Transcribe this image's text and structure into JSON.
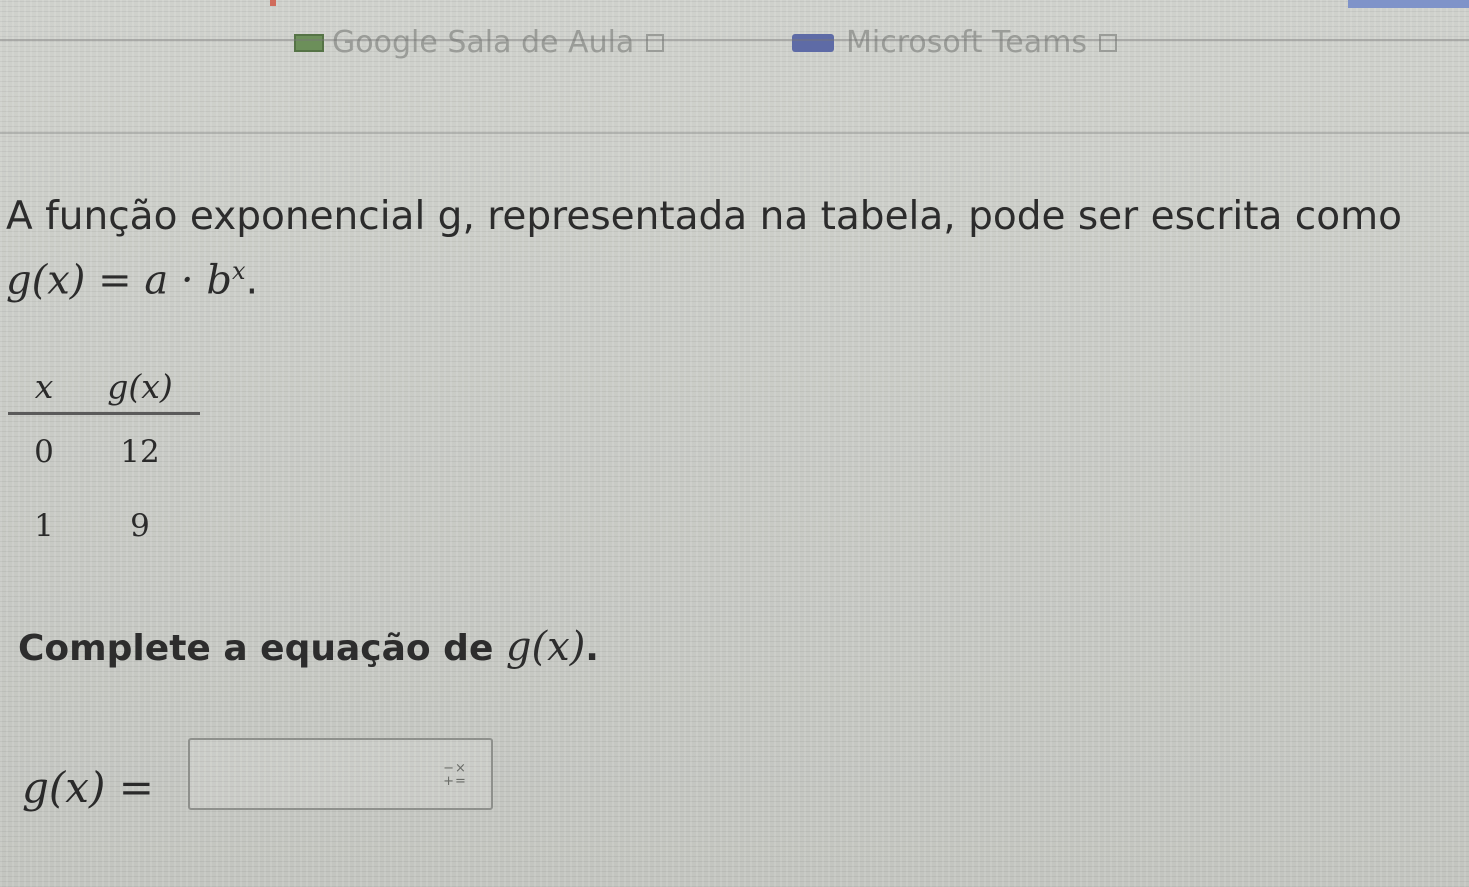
{
  "bookmarks": [
    {
      "label": "Google Sala de Aula"
    },
    {
      "label": "Microsoft Teams"
    }
  ],
  "question": {
    "intro_text": "A função exponencial g, representada na tabela, pode ser escrita como",
    "formula_lhs": "g(x)",
    "formula_equals": "=",
    "formula_a": "a",
    "formula_dot": "·",
    "formula_b": "b",
    "formula_exponent": "x",
    "formula_period": "."
  },
  "table": {
    "headers": [
      "x",
      "g(x)"
    ],
    "rows": [
      [
        "0",
        "12"
      ],
      [
        "1",
        "9"
      ]
    ]
  },
  "prompt": {
    "text": "Complete a equação de",
    "math": "g(x)",
    "period": "."
  },
  "answer": {
    "label": "g(x) =",
    "value": "",
    "keypad_top": "−×",
    "keypad_bottom": "+="
  },
  "colors": {
    "background": "#c9cbc6",
    "text": "#2a2a2a",
    "classroom_icon": "#6c8f5a",
    "teams_icon": "#5e6ba6"
  }
}
